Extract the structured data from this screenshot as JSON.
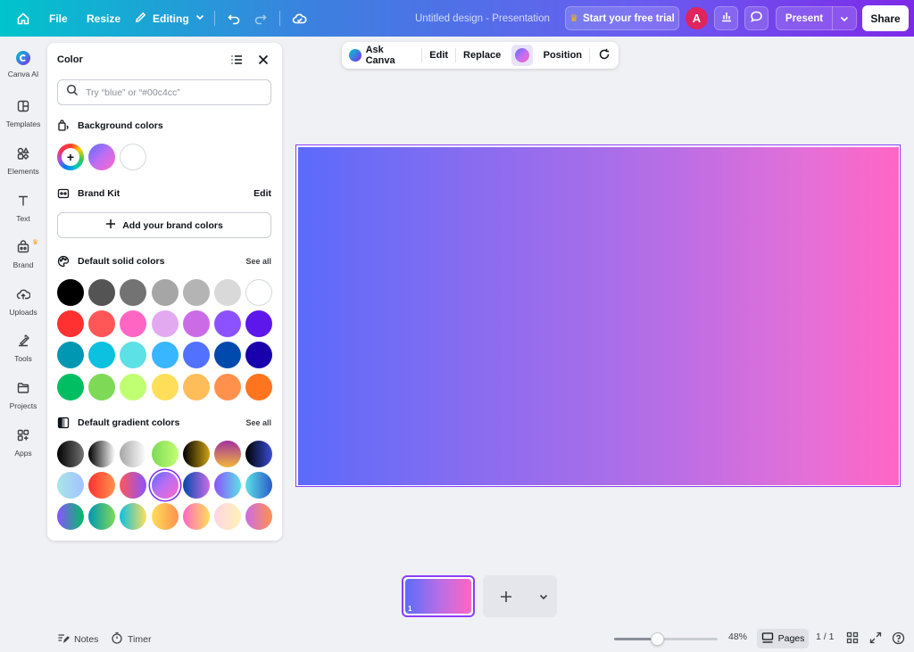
{
  "topbar": {
    "file_label": "File",
    "resize_label": "Resize",
    "editing_label": "Editing",
    "doc_title": "Untitled design - Presentation",
    "trial_label": "Start your free trial",
    "avatar_initial": "A",
    "present_label": "Present",
    "share_label": "Share"
  },
  "rail": {
    "items": [
      {
        "label": "Canva AI",
        "icon": "canva-ai-icon"
      },
      {
        "label": "Templates",
        "icon": "templates-icon"
      },
      {
        "label": "Elements",
        "icon": "elements-icon"
      },
      {
        "label": "Text",
        "icon": "text-icon"
      },
      {
        "label": "Brand",
        "icon": "brand-icon"
      },
      {
        "label": "Uploads",
        "icon": "uploads-icon"
      },
      {
        "label": "Tools",
        "icon": "tools-icon"
      },
      {
        "label": "Projects",
        "icon": "projects-icon"
      },
      {
        "label": "Apps",
        "icon": "apps-icon"
      }
    ]
  },
  "color_panel": {
    "title": "Color",
    "search_placeholder": "Try “blue” or “#00c4cc”",
    "background_colors_label": "Background colors",
    "brand_kit_label": "Brand Kit",
    "brand_kit_edit": "Edit",
    "add_brand_label": "Add your brand colors",
    "solid_label": "Default solid colors",
    "solid_see_all": "See all",
    "gradient_label": "Default gradient colors",
    "gradient_see_all": "See all",
    "background_swatches": [
      "linear-gradient(135deg, #5b6cf9, #c06ef2, #ff66c4)",
      "#ffffff"
    ],
    "solid_colors": [
      [
        "#000000",
        "#545454",
        "#737373",
        "#a6a6a6",
        "#b4b4b4",
        "#d9d9d9",
        "#ffffff"
      ],
      [
        "#ff3131",
        "#ff5757",
        "#ff66c4",
        "#e2a9f1",
        "#cb6ce6",
        "#8c52ff",
        "#5e17eb"
      ],
      [
        "#0097b2",
        "#0cc0df",
        "#5ce1e6",
        "#38b6ff",
        "#5271ff",
        "#004aad",
        "#1800ad"
      ],
      [
        "#00bf63",
        "#7ed957",
        "#c1ff72",
        "#ffde59",
        "#ffbd59",
        "#ff914d",
        "#ff751f"
      ]
    ],
    "gradient_colors": [
      [
        "linear-gradient(90deg,#000000,#737373)",
        "linear-gradient(90deg,#000000,#ffffff)",
        "linear-gradient(90deg,#a6a6a6,#ffffff)",
        "linear-gradient(90deg,#7ed957,#c1ff72)",
        "linear-gradient(90deg,#000000,#cfa215)",
        "linear-gradient(180deg,#a0309e,#f2b63a)",
        "linear-gradient(90deg,#000000,#3b4dd4)"
      ],
      [
        "linear-gradient(90deg,#a6e6e6,#a4c2ff)",
        "linear-gradient(90deg,#ff3131,#ff914d)",
        "linear-gradient(90deg,#ff5757,#8c52ff)",
        "linear-gradient(135deg,#5b6cf9,#c06ef2,#ff66c4)",
        "linear-gradient(90deg,#004aad,#cb6ce6)",
        "linear-gradient(90deg,#8c52ff,#5ce1e6)",
        "linear-gradient(90deg,#5ce1e6,#2a5bc7)"
      ],
      [
        "linear-gradient(90deg,#8c52ff,#00bf63)",
        "linear-gradient(90deg,#0097b2,#7ed957)",
        "linear-gradient(90deg,#0cc0df,#ffde59)",
        "linear-gradient(90deg,#ffde59,#ff914d)",
        "linear-gradient(90deg,#ff66c4,#ffde59)",
        "linear-gradient(90deg,#ffd4e4,#fff2b8)",
        "linear-gradient(90deg,#cb6ce6,#ff914d)"
      ]
    ],
    "selected_gradient": [
      1,
      3
    ]
  },
  "context_toolbar": {
    "ask_canva": "Ask Canva",
    "edit": "Edit",
    "replace": "Replace",
    "position": "Position"
  },
  "canvas": {
    "background": "linear-gradient(90deg, #5b6bfa, #ff66c4)"
  },
  "pages": {
    "thumb_number": "1"
  },
  "bottombar": {
    "notes_label": "Notes",
    "timer_label": "Timer",
    "zoom_label": "48%",
    "zoom_fraction": 0.42,
    "pages_label": "Pages",
    "page_count": "1 / 1"
  }
}
